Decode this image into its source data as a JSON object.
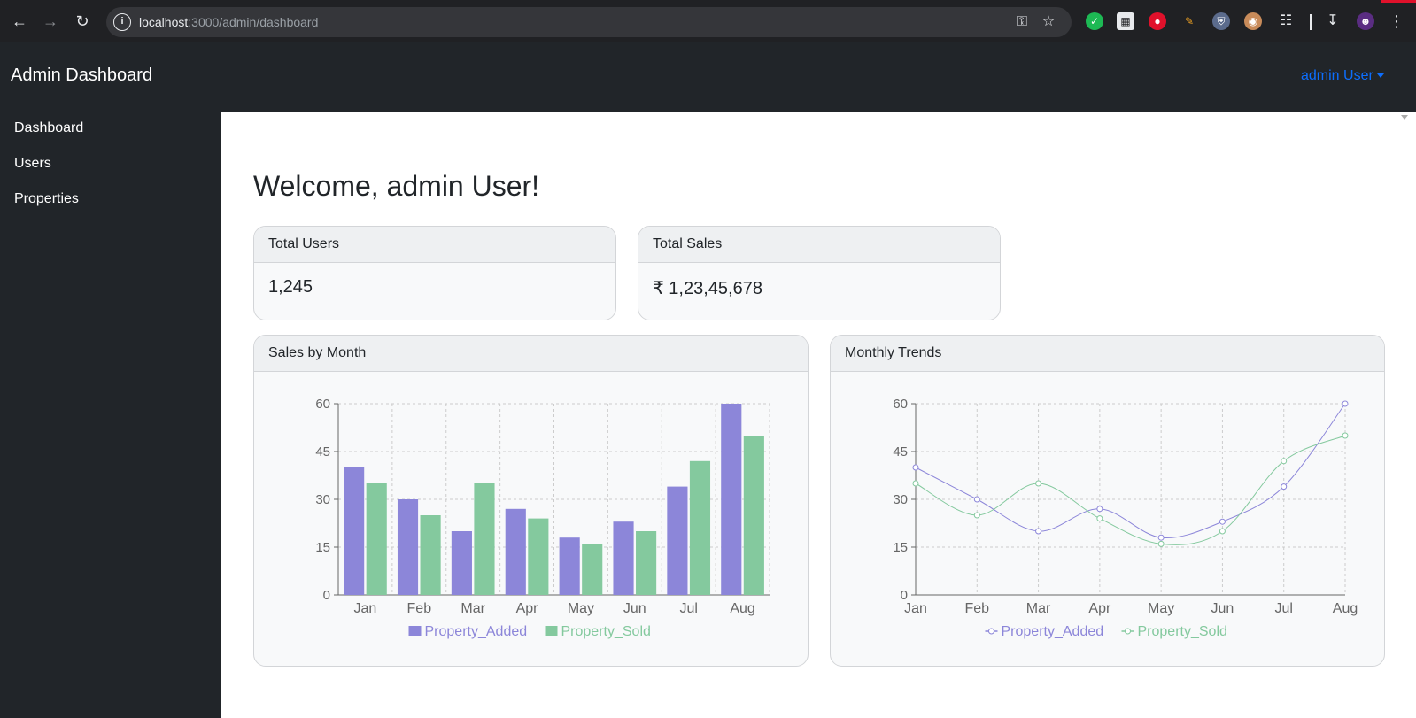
{
  "browser": {
    "url_host": "localhost",
    "url_path": ":3000/admin/dashboard"
  },
  "navbar": {
    "brand": "Admin Dashboard",
    "user_menu": "admin User"
  },
  "sidebar": {
    "items": [
      {
        "label": "Dashboard"
      },
      {
        "label": "Users"
      },
      {
        "label": "Properties"
      }
    ]
  },
  "main": {
    "welcome": "Welcome, admin User!",
    "stats": [
      {
        "title": "Total Users",
        "value": "1,245"
      },
      {
        "title": "Total Sales",
        "value": "₹ 1,23,45,678"
      }
    ],
    "charts": [
      {
        "title": "Sales by Month"
      },
      {
        "title": "Monthly Trends"
      }
    ]
  },
  "colors": {
    "added": "#8c86d9",
    "sold": "#84c99e",
    "link": "#0d6efd"
  },
  "chart_data": [
    {
      "type": "bar",
      "categories": [
        "Jan",
        "Feb",
        "Mar",
        "Apr",
        "May",
        "Jun",
        "Jul",
        "Aug"
      ],
      "series": [
        {
          "name": "Property_Added",
          "values": [
            40,
            30,
            20,
            27,
            18,
            23,
            34,
            60
          ]
        },
        {
          "name": "Property_Sold",
          "values": [
            35,
            25,
            35,
            24,
            16,
            20,
            42,
            50
          ]
        }
      ],
      "yticks": [
        0,
        15,
        30,
        45,
        60
      ],
      "ylim": [
        0,
        60
      ],
      "grid": true,
      "legend": "bottom"
    },
    {
      "type": "line",
      "categories": [
        "Jan",
        "Feb",
        "Mar",
        "Apr",
        "May",
        "Jun",
        "Jul",
        "Aug"
      ],
      "series": [
        {
          "name": "Property_Added",
          "values": [
            40,
            30,
            20,
            27,
            18,
            23,
            34,
            60
          ]
        },
        {
          "name": "Property_Sold",
          "values": [
            35,
            25,
            35,
            24,
            16,
            20,
            42,
            50
          ]
        }
      ],
      "yticks": [
        0,
        15,
        30,
        45,
        60
      ],
      "ylim": [
        0,
        60
      ],
      "grid": true,
      "legend": "bottom"
    }
  ]
}
